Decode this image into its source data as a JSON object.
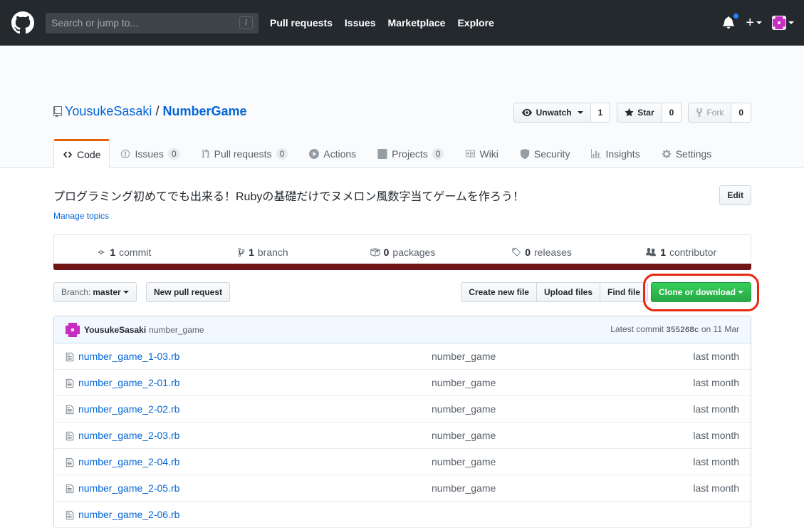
{
  "header": {
    "search_placeholder": "Search or jump to...",
    "search_shortcut": "/",
    "nav": [
      "Pull requests",
      "Issues",
      "Marketplace",
      "Explore"
    ],
    "plus": "+"
  },
  "repo": {
    "owner": "YousukeSasaki",
    "separator": "/",
    "name": "NumberGame",
    "watch": {
      "label": "Unwatch",
      "count": "1"
    },
    "star": {
      "label": "Star",
      "count": "0"
    },
    "fork": {
      "label": "Fork",
      "count": "0"
    }
  },
  "tabs": [
    {
      "label": "Code",
      "counter": null
    },
    {
      "label": "Issues",
      "counter": "0"
    },
    {
      "label": "Pull requests",
      "counter": "0"
    },
    {
      "label": "Actions",
      "counter": null
    },
    {
      "label": "Projects",
      "counter": "0"
    },
    {
      "label": "Wiki",
      "counter": null
    },
    {
      "label": "Security",
      "counter": null
    },
    {
      "label": "Insights",
      "counter": null
    },
    {
      "label": "Settings",
      "counter": null
    }
  ],
  "description": "プログラミング初めてでも出来る！Rubyの基礎だけでヌメロン風数字当てゲームを作ろう！",
  "edit_label": "Edit",
  "manage_topics": "Manage topics",
  "summary": {
    "commits": {
      "num": "1",
      "label": "commit"
    },
    "branches": {
      "num": "1",
      "label": "branch"
    },
    "packages": {
      "num": "0",
      "label": "packages"
    },
    "releases": {
      "num": "0",
      "label": "releases"
    },
    "contributors": {
      "num": "1",
      "label": "contributor"
    }
  },
  "language_color": "#701516",
  "filenav": {
    "branch_label": "Branch:",
    "branch_name": "master",
    "new_pr": "New pull request",
    "create_file": "Create new file",
    "upload_files": "Upload files",
    "find_file": "Find file",
    "clone": "Clone or download"
  },
  "commit": {
    "author": "YousukeSasaki",
    "message": "number_game",
    "latest_prefix": "Latest commit",
    "sha": "355268c",
    "date": "on 11 Mar"
  },
  "files": [
    {
      "name": "number_game_1-03.rb",
      "message": "number_game",
      "age": "last month"
    },
    {
      "name": "number_game_2-01.rb",
      "message": "number_game",
      "age": "last month"
    },
    {
      "name": "number_game_2-02.rb",
      "message": "number_game",
      "age": "last month"
    },
    {
      "name": "number_game_2-03.rb",
      "message": "number_game",
      "age": "last month"
    },
    {
      "name": "number_game_2-04.rb",
      "message": "number_game",
      "age": "last month"
    },
    {
      "name": "number_game_2-05.rb",
      "message": "number_game",
      "age": "last month"
    },
    {
      "name": "number_game_2-06.rb",
      "message": "",
      "age": ""
    }
  ]
}
